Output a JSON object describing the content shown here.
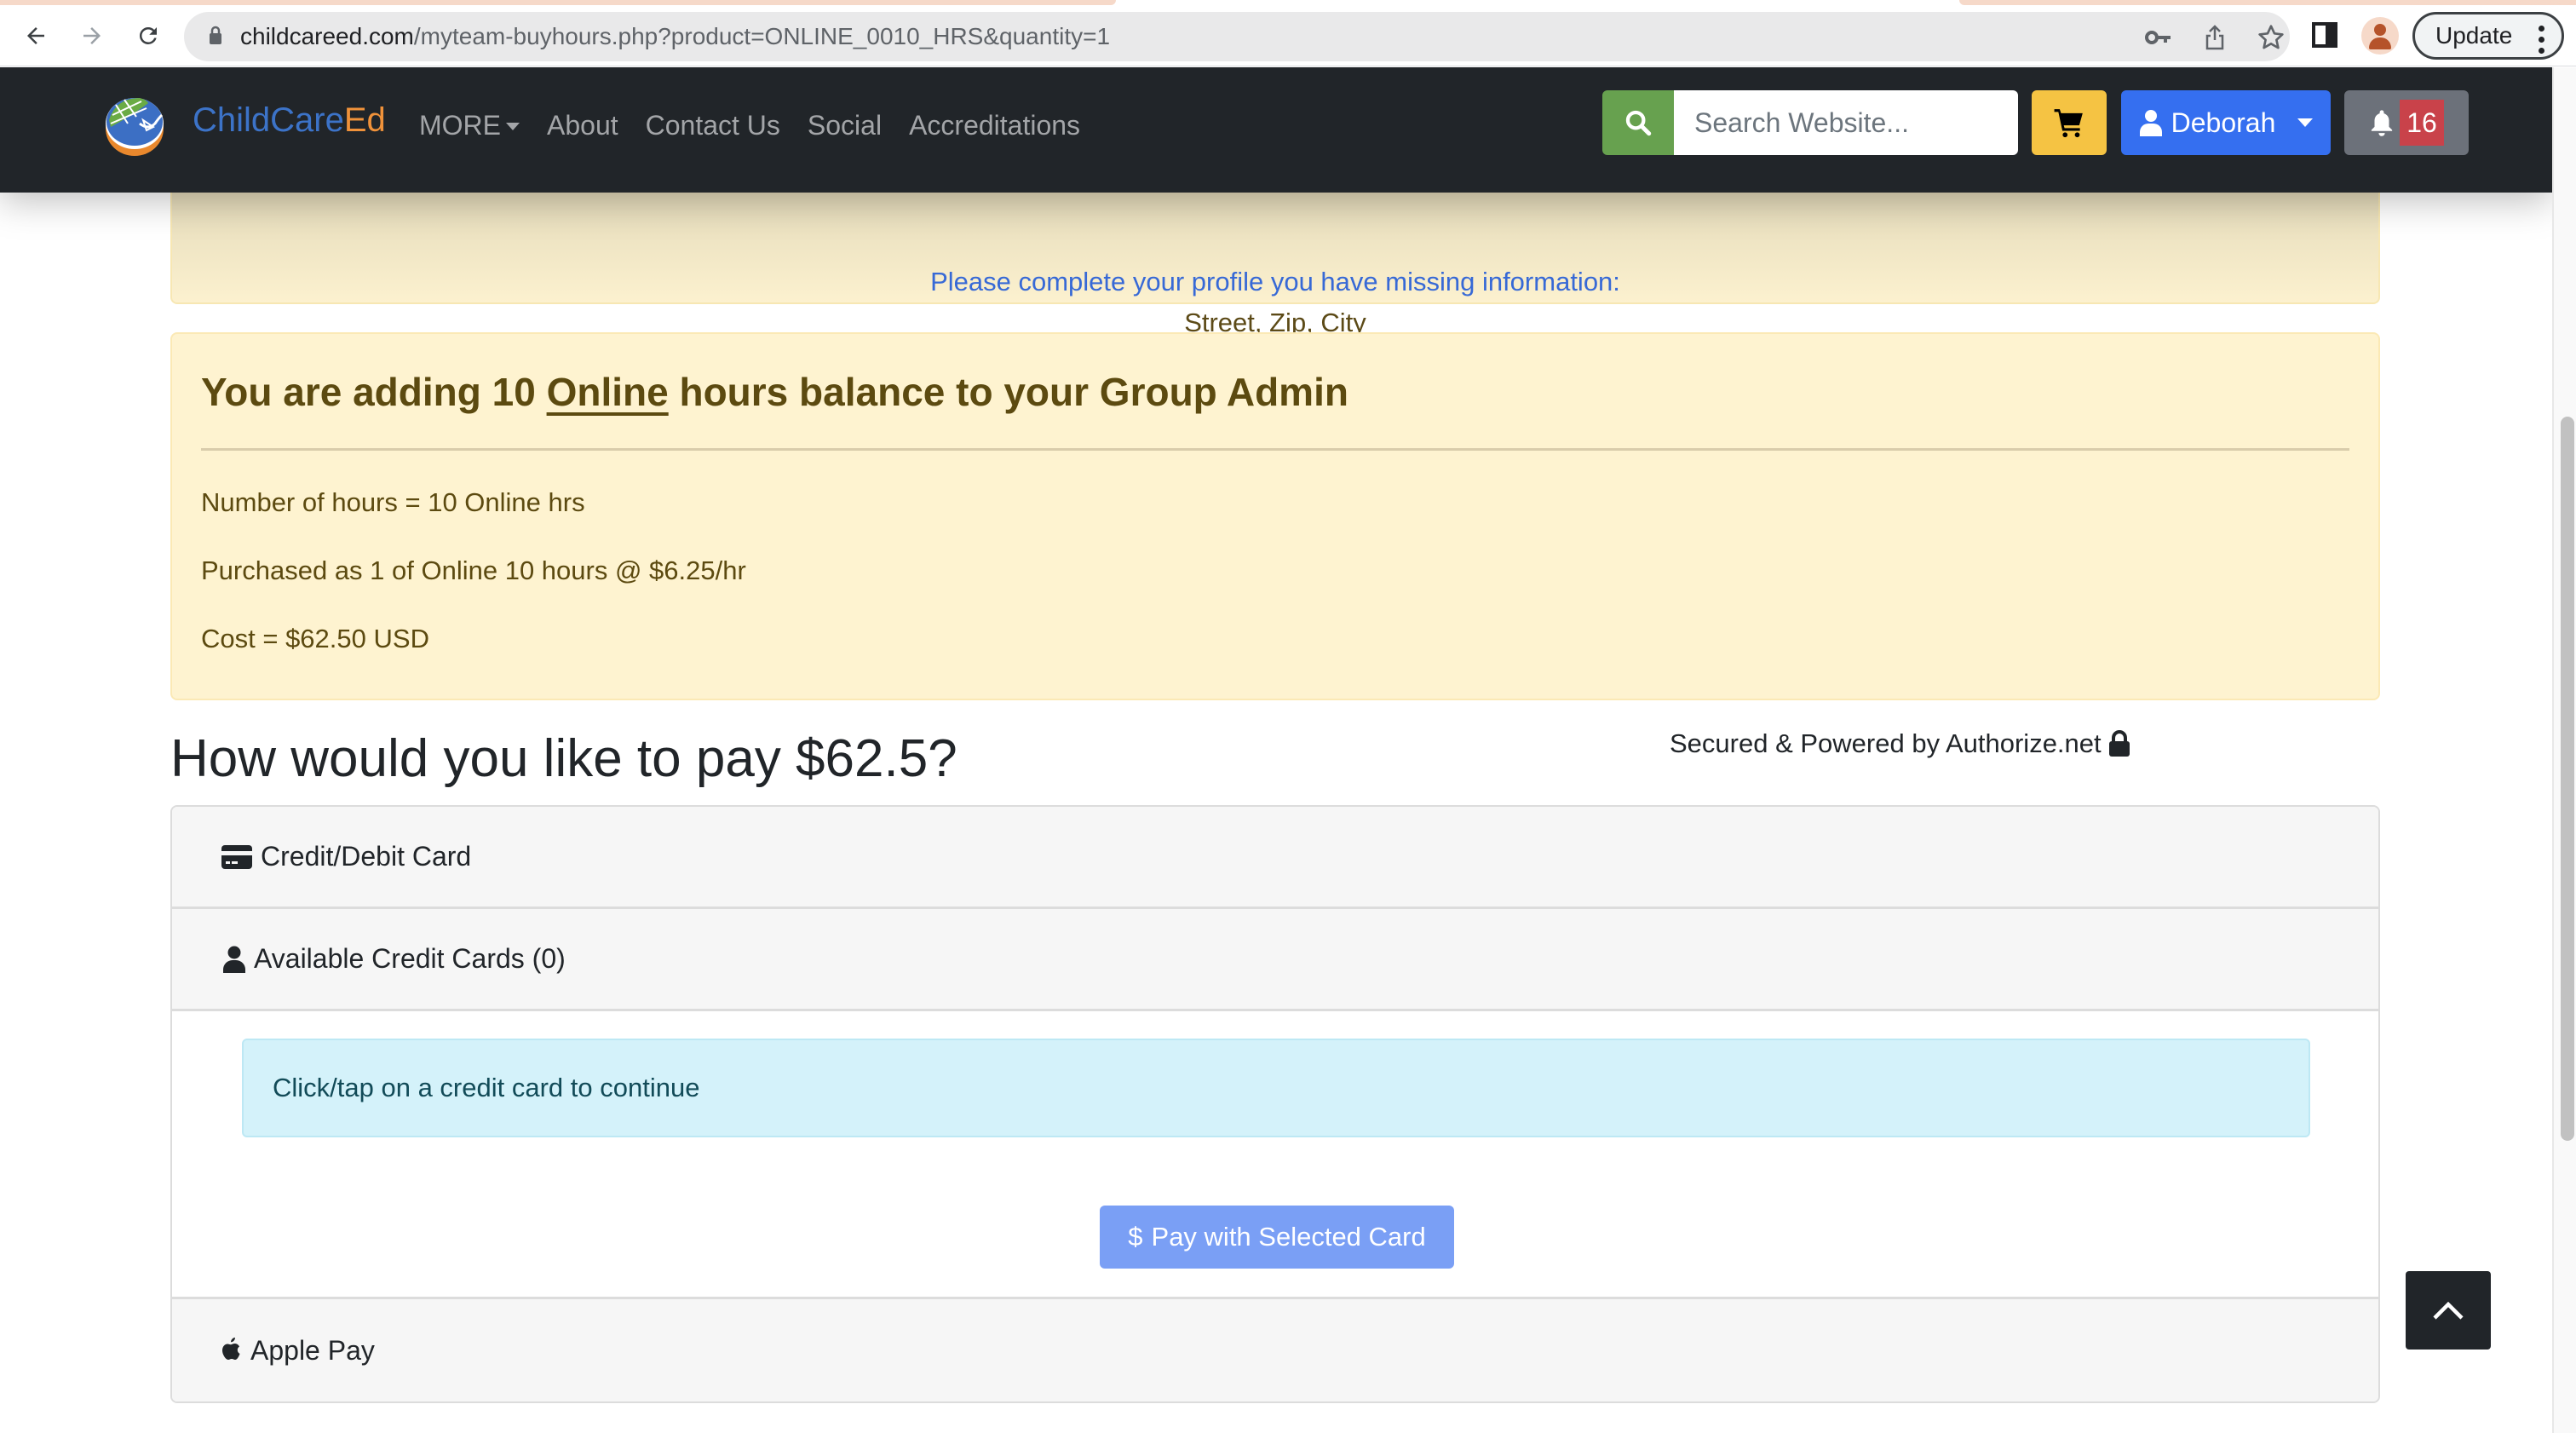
{
  "browser": {
    "url_host": "childcareed.com",
    "url_rest": "/myteam-buyhours.php?product=ONLINE_0010_HRS&quantity=1",
    "update_label": "Update"
  },
  "site": {
    "brand_part1": "ChildCare",
    "brand_part2": "Ed",
    "nav": [
      {
        "label": "MORE",
        "has_dropdown": true
      },
      {
        "label": "About"
      },
      {
        "label": "Contact Us"
      },
      {
        "label": "Social"
      },
      {
        "label": "Accreditations"
      }
    ],
    "search_placeholder": "Search Website...",
    "user_name": "Deborah",
    "notification_count": "16",
    "colors": {
      "navbar": "#212529",
      "search_button": "#67a14f",
      "cart_button": "#f5c343",
      "user_button": "#356ff0",
      "notif_button": "#6c717a",
      "badge": "#c9424a"
    }
  },
  "profile_alert": {
    "message": "Please complete your profile you have missing information:",
    "missing_fields": "Street, Zip, City"
  },
  "summary": {
    "title_pre": "You are adding 10 ",
    "title_link": "Online",
    "title_post": " hours balance to your Group Admin",
    "lines": [
      "Number of hours = 10 Online hrs",
      "Purchased as 1 of Online 10 hours @ $6.25/hr",
      "Cost = $62.50 USD"
    ]
  },
  "payment": {
    "heading": "How would you like to pay $62.5?",
    "secured_text": "Secured & Powered by Authorize.net",
    "sections": {
      "card_label": "Credit/Debit Card",
      "saved_cards_label": "Available Credit Cards (0)",
      "info_text": "Click/tap on a credit card to continue",
      "pay_button": "Pay with Selected Card",
      "apple_pay_label": "Apple Pay"
    }
  }
}
